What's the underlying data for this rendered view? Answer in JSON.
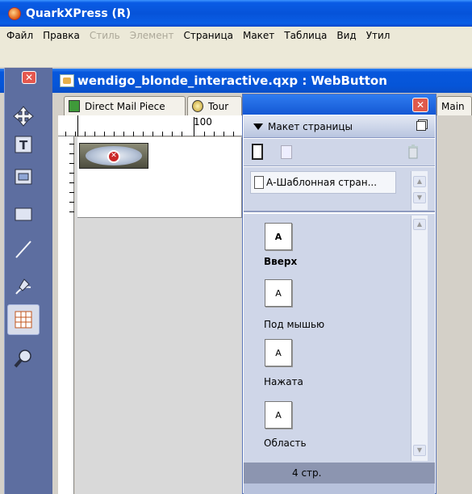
{
  "app": {
    "title": "QuarkXPress (R)"
  },
  "menu": [
    {
      "label": "Файл",
      "disabled": false
    },
    {
      "label": "Правка",
      "disabled": false
    },
    {
      "label": "Стиль",
      "disabled": true
    },
    {
      "label": "Элемент",
      "disabled": true
    },
    {
      "label": "Страница",
      "disabled": false
    },
    {
      "label": "Макет",
      "disabled": false
    },
    {
      "label": "Таблица",
      "disabled": false
    },
    {
      "label": "Вид",
      "disabled": false
    },
    {
      "label": "Утил",
      "disabled": false
    }
  ],
  "document": {
    "title": "wendigo_blonde_interactive.qxp : WebButton",
    "tabs": [
      {
        "label": "Direct Mail Piece"
      },
      {
        "label": "Tour"
      },
      {
        "label": "Main"
      }
    ],
    "ruler": {
      "mark": "100"
    }
  },
  "palette": {
    "title": "Макет страницы",
    "master_pages": [
      "А-Шаблонная стран..."
    ],
    "pages": [
      {
        "letter": "A",
        "label": "Вверх",
        "selected": true
      },
      {
        "letter": "A",
        "label": "Под мышью",
        "selected": false
      },
      {
        "letter": "A",
        "label": "Нажата",
        "selected": false
      },
      {
        "letter": "A",
        "label": "Область",
        "selected": false
      }
    ],
    "footer": "4 стр."
  },
  "colors": {
    "title_bar": "#0653d9",
    "toolbox": "#5d6ea0",
    "palette_bg": "#cfd6e8",
    "close_button": "#e05a4b"
  },
  "icons": {
    "app_logo": "quark-logo-icon",
    "tools": [
      "move-icon",
      "text-content-icon",
      "picture-content-icon",
      "rectangle-box-icon",
      "line-icon",
      "pen-bezier-icon",
      "table-icon",
      "zoom-icon"
    ]
  }
}
